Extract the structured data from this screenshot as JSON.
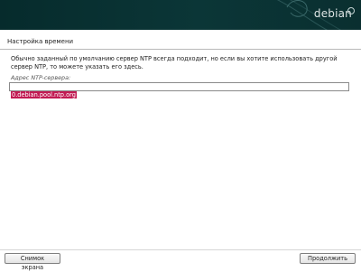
{
  "header": {
    "brand_label": "debian"
  },
  "step": {
    "title": "Настройка времени"
  },
  "main": {
    "description": "Обычно заданный по умолчанию сервер NTP всегда подходит, но если вы хотите использовать другой сервер NTP, то можете указать его здесь.",
    "ntp_field": {
      "label": "Адрес NTP-сервера:",
      "value": "0.debian.pool.ntp.org"
    }
  },
  "footer": {
    "screenshot_label": "Снимок экрана",
    "continue_label": "Продолжить"
  },
  "colors": {
    "banner": "#0b3637",
    "selection": "#c21b53"
  }
}
